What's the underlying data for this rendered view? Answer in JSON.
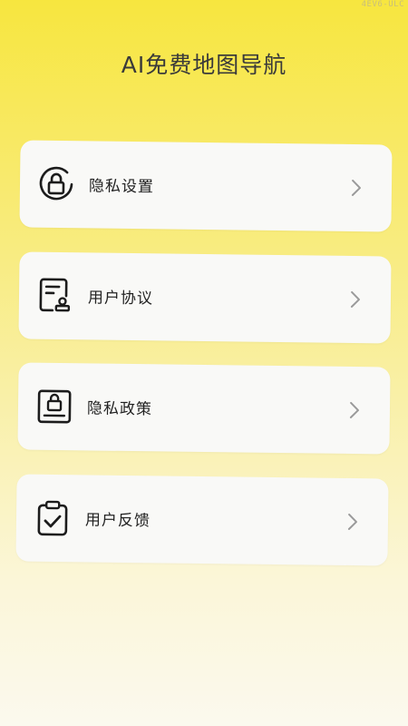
{
  "watermark": "4EV6-ULC",
  "app": {
    "title": "AI免费地图导航"
  },
  "menu": [
    {
      "label": "隐私设置",
      "icon": "lock-circle-icon"
    },
    {
      "label": "用户协议",
      "icon": "document-stamp-icon"
    },
    {
      "label": "隐私政策",
      "icon": "lock-document-icon"
    },
    {
      "label": "用户反馈",
      "icon": "clipboard-check-icon"
    }
  ],
  "colors": {
    "accent": "#f7e63f",
    "card": "#f9f9f7",
    "text": "#222222",
    "chevron": "#9a9a9a"
  }
}
